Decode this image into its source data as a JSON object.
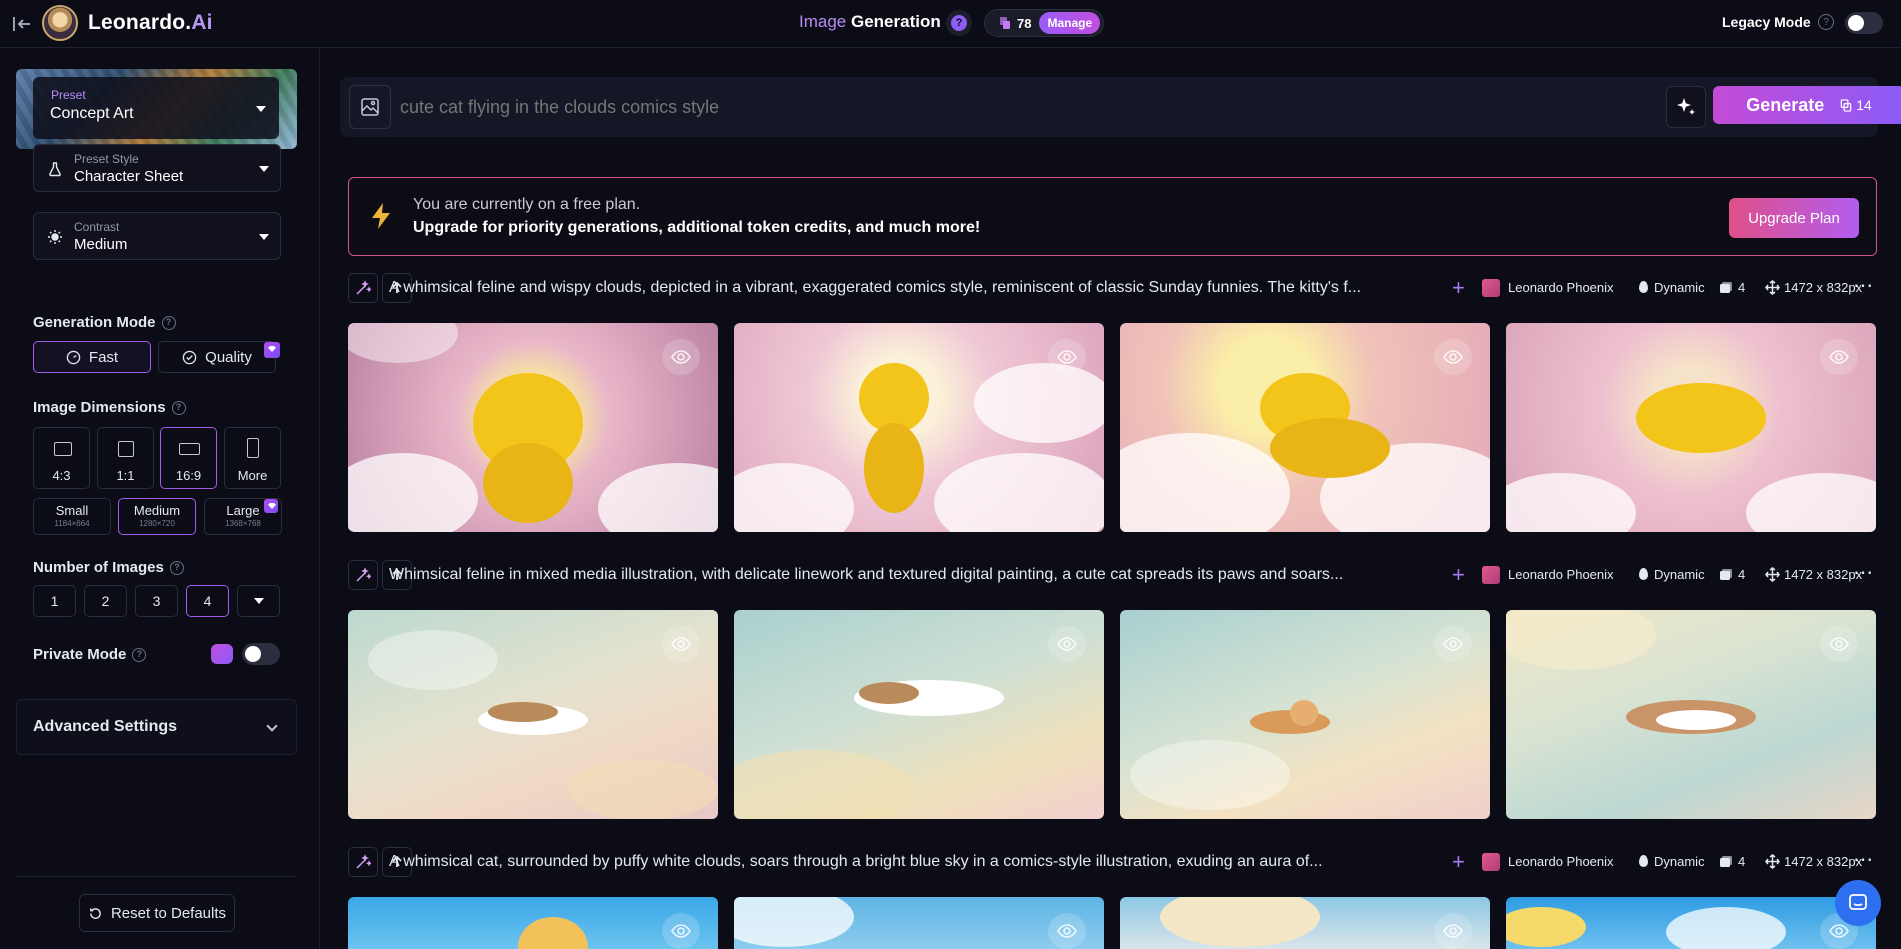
{
  "header": {
    "brand": "Leonardo.",
    "brand_suffix": "Ai",
    "title_part1": "Image",
    "title_part2": "Generation",
    "help": "?",
    "token_count": "78",
    "manage_label": "Manage",
    "legacy_mode_label": "Legacy Mode",
    "legacy_help": "?"
  },
  "sidebar": {
    "preset_label": "Preset",
    "preset_value": "Concept Art",
    "preset_style_label": "Preset Style",
    "preset_style_value": "Character Sheet",
    "contrast_label": "Contrast",
    "contrast_value": "Medium",
    "generation_mode_title": "Generation Mode",
    "mode_fast": "Fast",
    "mode_quality": "Quality",
    "image_dimensions_title": "Image Dimensions",
    "aspect_ratios": [
      "4:3",
      "1:1",
      "16:9",
      "More"
    ],
    "sizes": [
      {
        "name": "Small",
        "px": "1184×664"
      },
      {
        "name": "Medium",
        "px": "1280×720"
      },
      {
        "name": "Large",
        "px": "1368×768"
      }
    ],
    "number_of_images_title": "Number of Images",
    "number_options": [
      "1",
      "2",
      "3",
      "4"
    ],
    "private_mode_title": "Private Mode",
    "advanced_settings": "Advanced Settings",
    "reset_label": "Reset to Defaults"
  },
  "prompt": {
    "placeholder": "cute cat flying in the clouds comics style",
    "generate_label": "Generate",
    "generate_tokens": "14"
  },
  "upgrade": {
    "line1": "You are currently on a free plan.",
    "line2": "Upgrade for priority generations, additional token credits, and much more!",
    "button": "Upgrade Plan"
  },
  "generations": [
    {
      "prompt": "A whimsical feline and wispy clouds, depicted in a vibrant, exaggerated comics style, reminiscent of classic Sunday funnies. The kitty's f...",
      "model": "Leonardo Phoenix",
      "style": "Dynamic",
      "count": "4",
      "dimensions": "1472 x 832px"
    },
    {
      "prompt": "Whimsical feline in mixed media illustration, with delicate linework and textured digital painting, a cute cat spreads its paws and soars...",
      "model": "Leonardo Phoenix",
      "style": "Dynamic",
      "count": "4",
      "dimensions": "1472 x 832px"
    },
    {
      "prompt": "A whimsical cat, surrounded by puffy white clouds, soars through a bright blue sky in a comics-style illustration, exuding an aura of...",
      "model": "Leonardo Phoenix",
      "style": "Dynamic",
      "count": "4",
      "dimensions": "1472 x 832px"
    }
  ],
  "colors": {
    "accent_purple": "#8b5cf6",
    "accent_pink": "#c44bd8",
    "banner_border": "#d6528f",
    "background": "#0b0c15"
  }
}
